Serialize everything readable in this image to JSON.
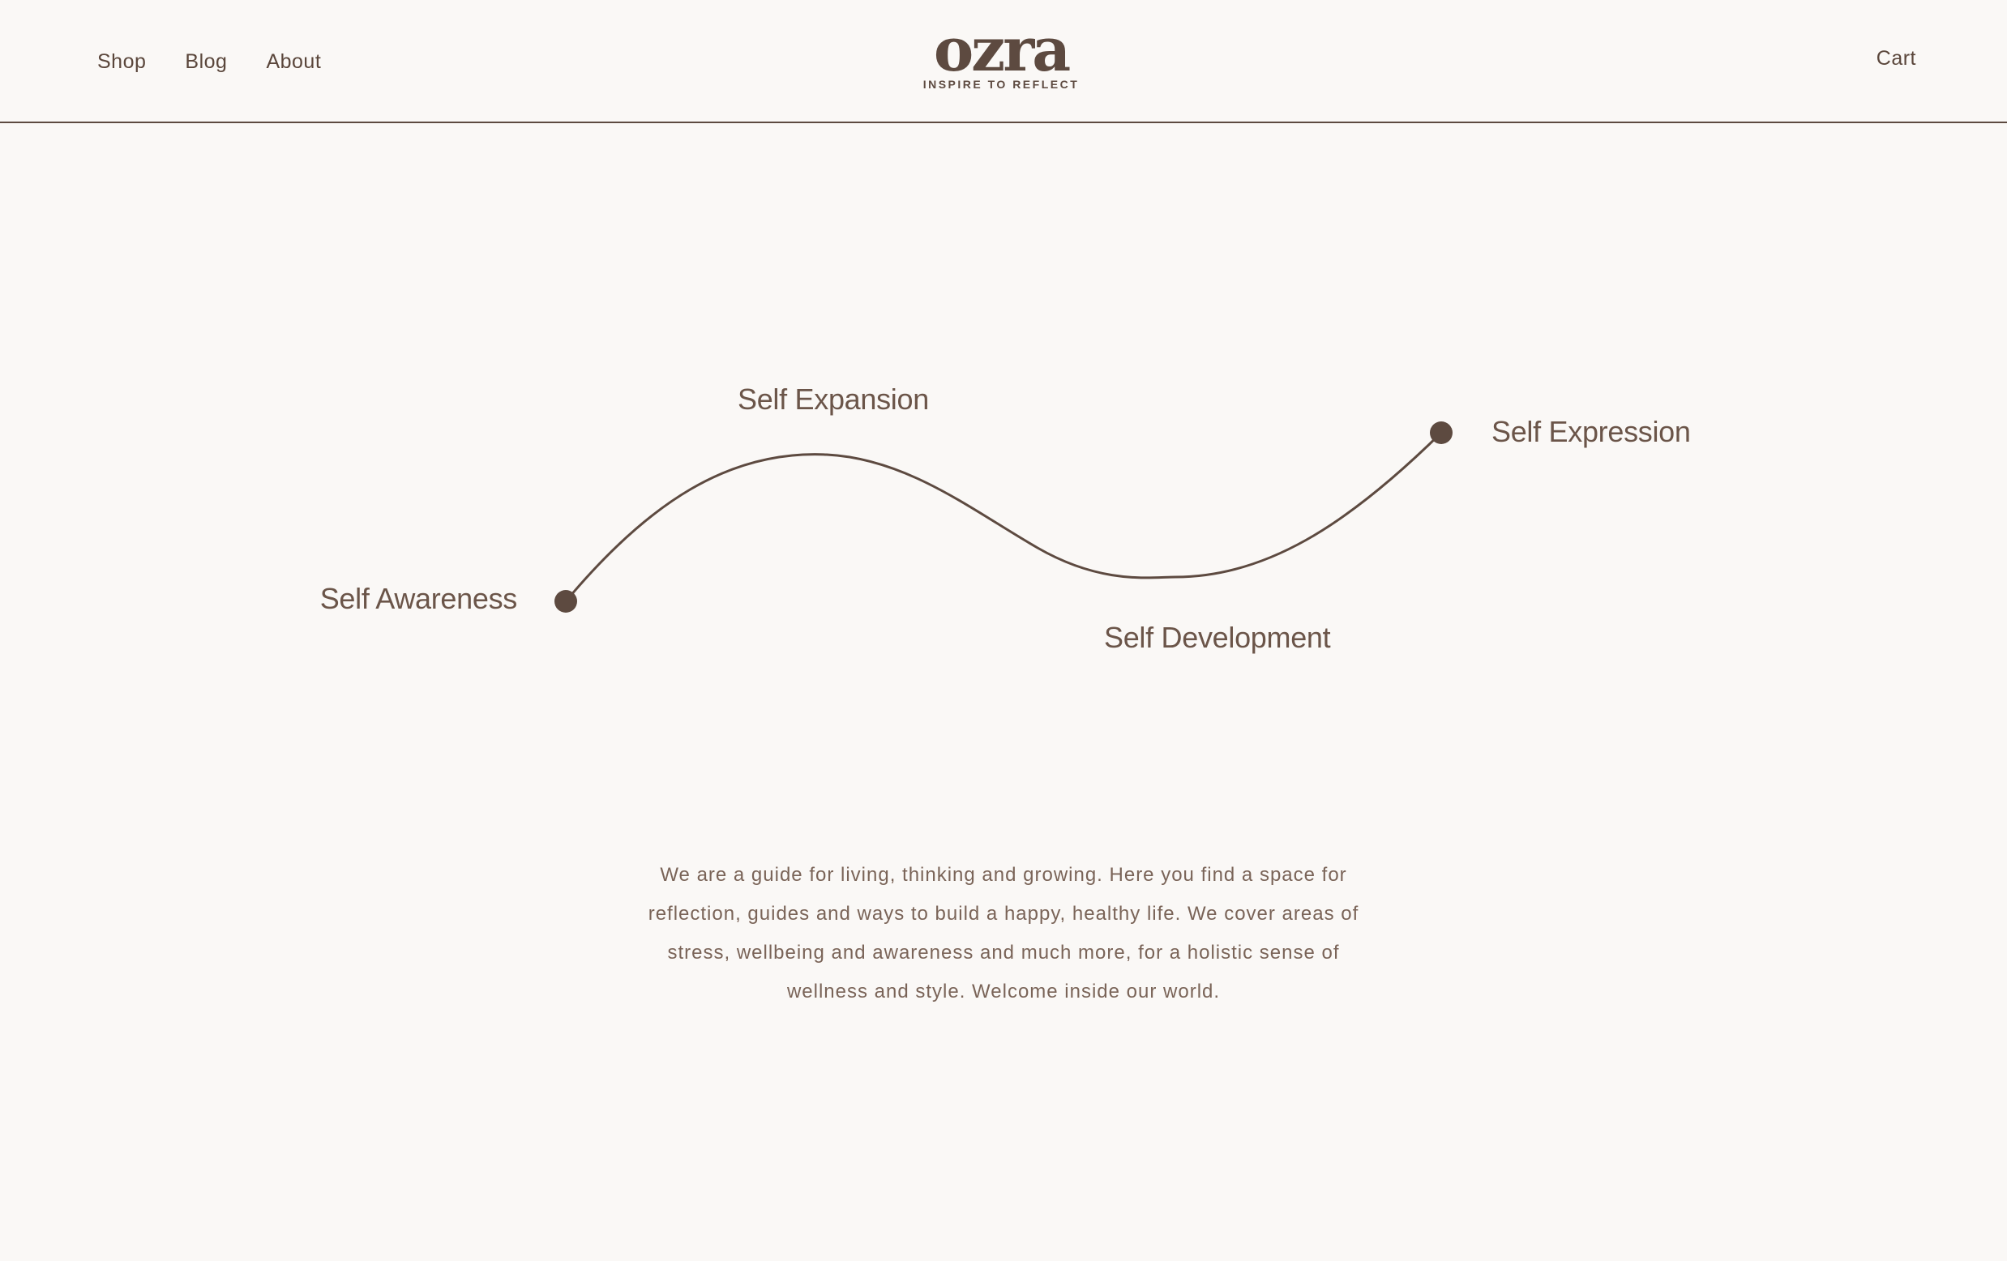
{
  "header": {
    "nav": [
      {
        "label": "Shop"
      },
      {
        "label": "Blog"
      },
      {
        "label": "About"
      }
    ],
    "logo": {
      "word": "ozra",
      "tagline": "INSPIRE TO REFLECT"
    },
    "cart_label": "Cart"
  },
  "journey": {
    "stages": {
      "awareness": "Self Awareness",
      "expansion": "Self Expansion",
      "development": "Self Development",
      "expression": "Self Expression"
    }
  },
  "intro": {
    "text": "We are a guide for living, thinking and growing. Here you find a space for reflection, guides and ways to build a happy, healthy life. We cover areas of stress, wellbeing and awareness and much more, for a holistic sense of wellness and style. Welcome inside our world."
  },
  "colors": {
    "background": "#faf8f6",
    "brand_brown": "#5d4a40",
    "text_muted": "#7a6458"
  }
}
